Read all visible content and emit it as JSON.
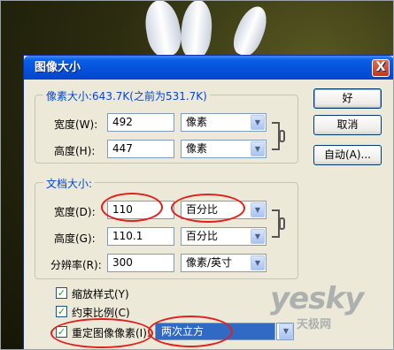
{
  "dialog": {
    "title": "图像大小",
    "close_glyph": "X",
    "pixel_group": {
      "legend": "像素大小:643.7K(之前为531.7K)",
      "width_label": "宽度(W):",
      "width_value": "492",
      "width_unit": "像素",
      "height_label": "高度(H):",
      "height_value": "447",
      "height_unit": "像素"
    },
    "doc_group": {
      "legend": "文档大小:",
      "width_label": "宽度(D):",
      "width_value": "110",
      "width_unit": "百分比",
      "height_label": "高度(G):",
      "height_value": "110.1",
      "height_unit": "百分比",
      "res_label": "分辨率(R):",
      "res_value": "300",
      "res_unit": "像素/英寸"
    },
    "buttons": {
      "ok": "好",
      "cancel": "取消",
      "auto": "自动(A)..."
    },
    "checkboxes": {
      "scale_styles": "缩放样式(Y)",
      "constrain": "约束比例(C)",
      "resample": "重定图像像素(I):",
      "check_glyph": "✓"
    },
    "resample_method": "两次立方",
    "dropdown_glyph": "▼"
  },
  "watermark": {
    "brand": "yesky",
    "sub": "天极网"
  }
}
